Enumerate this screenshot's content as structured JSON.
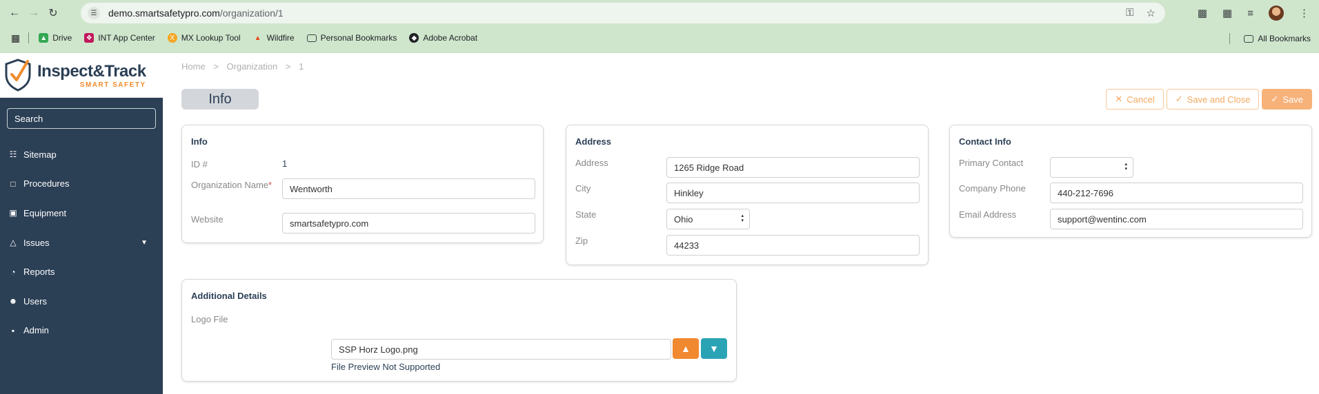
{
  "browser": {
    "url_host": "demo.smartsafetypro.com",
    "url_path": "/organization/1",
    "bookmarks": [
      {
        "label": "Drive",
        "icon": "drive-icon",
        "color": "#34a853"
      },
      {
        "label": "INT App Center",
        "icon": "int-icon",
        "color": "#c2185b"
      },
      {
        "label": "MX Lookup Tool",
        "icon": "mx-icon",
        "color": "#f5a623"
      },
      {
        "label": "Wildfire",
        "icon": "wildfire-icon",
        "color": "#e64a19"
      },
      {
        "label": "Personal Bookmarks",
        "icon": "folder-icon",
        "color": "#3c4043"
      },
      {
        "label": "Adobe Acrobat",
        "icon": "acrobat-icon",
        "color": "#202124"
      }
    ],
    "all_bookmarks": "All Bookmarks"
  },
  "brand": {
    "name": "Inspect&Track",
    "tagline": "SMART SAFETY"
  },
  "sidebar": {
    "search_placeholder": "Search",
    "items": [
      {
        "label": "Sitemap",
        "icon": "sitemap-icon"
      },
      {
        "label": "Procedures",
        "icon": "book-icon"
      },
      {
        "label": "Equipment",
        "icon": "toolbox-icon"
      },
      {
        "label": "Issues",
        "icon": "warning-icon"
      },
      {
        "label": "Reports",
        "icon": "chart-pie-icon"
      },
      {
        "label": "Users",
        "icon": "users-icon"
      },
      {
        "label": "Admin",
        "icon": "admin-icon"
      }
    ]
  },
  "breadcrumb": {
    "home": "Home",
    "sep1": ">",
    "section": "Organization",
    "sep2": ">",
    "id": "1"
  },
  "page": {
    "title": "Info"
  },
  "actions": {
    "cancel": "Cancel",
    "save_close": "Save and Close",
    "save": "Save"
  },
  "info": {
    "title": "Info",
    "id_label": "ID #",
    "id_value": "1",
    "name_label": "Organization Name",
    "name_required": "*",
    "name_value": "Wentworth",
    "website_label": "Website",
    "website_value": "smartsafetypro.com"
  },
  "address": {
    "title": "Address",
    "address_label": "Address",
    "address_value": "1265 Ridge Road",
    "city_label": "City",
    "city_value": "Hinkley",
    "state_label": "State",
    "state_value": "Ohio",
    "zip_label": "Zip",
    "zip_value": "44233"
  },
  "contact": {
    "title": "Contact Info",
    "primary_label": "Primary Contact",
    "primary_value": "",
    "phone_label": "Company Phone",
    "phone_value": "440-212-7696",
    "email_label": "Email Address",
    "email_value": "support@wentinc.com"
  },
  "details": {
    "title": "Additional Details",
    "logo_label": "Logo File",
    "file_name": "SSP Horz Logo.png",
    "preview_text": "File Preview Not Supported",
    "upload_color": "#f0892f",
    "download_color": "#2aa3b5"
  }
}
